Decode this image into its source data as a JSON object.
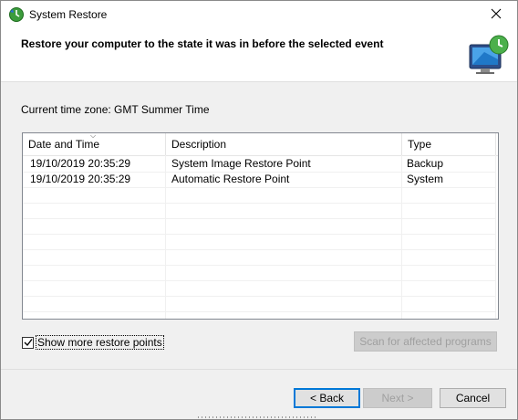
{
  "window": {
    "title": "System Restore",
    "title_icon": "system-restore-icon",
    "close_icon": "close-icon"
  },
  "header": {
    "title": "Restore your computer to the state it was in before the selected event",
    "icon": "system-restore-monitor-icon"
  },
  "timezone_label": "Current time zone: GMT Summer Time",
  "list": {
    "columns": [
      {
        "label": "Date and Time"
      },
      {
        "label": "Description"
      },
      {
        "label": "Type"
      }
    ],
    "rows": [
      {
        "date": "19/10/2019 20:35:29",
        "description": "System Image Restore Point",
        "type": "Backup"
      },
      {
        "date": "19/10/2019 20:35:29",
        "description": "Automatic Restore Point",
        "type": "System"
      }
    ]
  },
  "show_more": {
    "label": "Show more restore points",
    "checked": true
  },
  "buttons": {
    "scan": "Scan for affected programs",
    "back": "< Back",
    "next": "Next >",
    "cancel": "Cancel"
  },
  "colors": {
    "accent": "#0078d7",
    "disabled_text": "#a0a0a0"
  }
}
